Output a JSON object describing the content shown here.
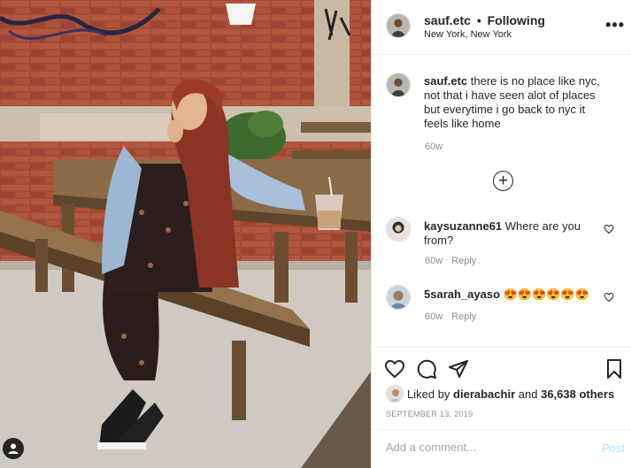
{
  "post": {
    "username": "sauf.etc",
    "dot": "•",
    "follow_status": "Following",
    "location": "New York, New York",
    "more_label": "•••"
  },
  "caption": {
    "username": "sauf.etc",
    "text": " there is no place like nyc, not that i have seen alot of places but everytime i go back to nyc it feels like home",
    "time": "60w"
  },
  "comments": [
    {
      "username": "kaysuzanne61",
      "text": " Where are you from?",
      "time": "60w",
      "reply": "Reply"
    },
    {
      "username": "5sarah_ayaso",
      "text": " 😍😍😍😍😍😍",
      "time": "60w",
      "reply": "Reply"
    }
  ],
  "likes": {
    "prefix": "Liked by ",
    "user": "dierabachir",
    "middle": " and ",
    "count": "36,638 others"
  },
  "date": "SEPTEMBER 13, 2019",
  "add_comment": {
    "placeholder": "Add a comment...",
    "post_label": "Post"
  },
  "icons": {
    "like": "heart-icon",
    "comment": "comment-icon",
    "share": "paper-plane-icon",
    "save": "bookmark-icon",
    "more": "more-options-icon",
    "load_more": "plus-circle-icon"
  }
}
